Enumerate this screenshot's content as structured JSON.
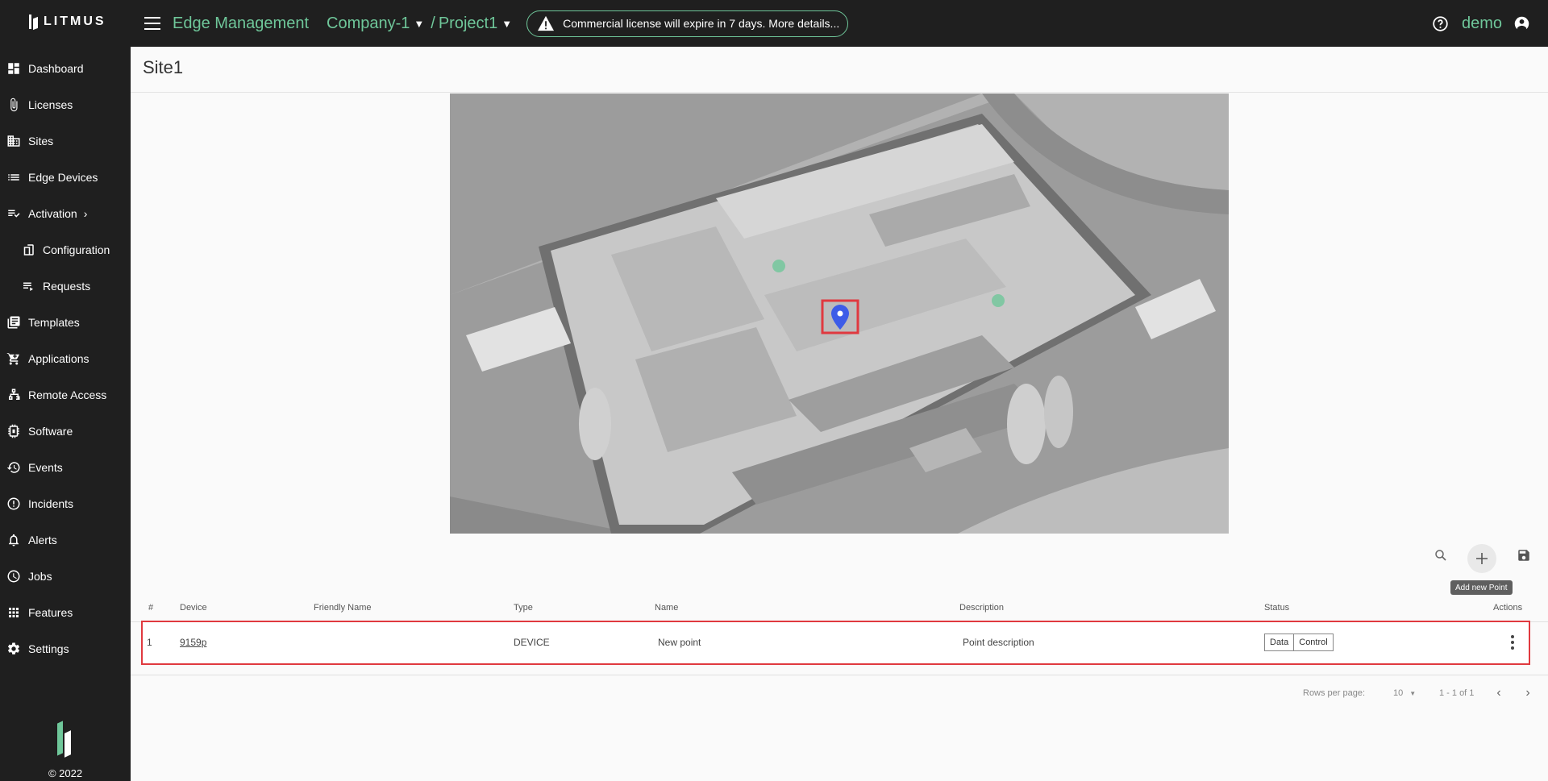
{
  "brand": {
    "logo_text": "LITMUS",
    "copyright": "© 2022"
  },
  "sidebar": {
    "items": [
      {
        "label": "Dashboard",
        "icon": "dashboard-icon"
      },
      {
        "label": "Licenses",
        "icon": "paperclip-icon"
      },
      {
        "label": "Sites",
        "icon": "building-icon"
      },
      {
        "label": "Edge Devices",
        "icon": "list-icon"
      },
      {
        "label": "Activation",
        "icon": "checklist-icon"
      },
      {
        "label": "Configuration",
        "icon": "configuration-icon"
      },
      {
        "label": "Requests",
        "icon": "requests-icon"
      },
      {
        "label": "Templates",
        "icon": "templates-icon"
      },
      {
        "label": "Applications",
        "icon": "cart-icon"
      },
      {
        "label": "Remote Access",
        "icon": "network-icon"
      },
      {
        "label": "Software",
        "icon": "chip-icon"
      },
      {
        "label": "Events",
        "icon": "history-icon"
      },
      {
        "label": "Incidents",
        "icon": "alert-circle-icon"
      },
      {
        "label": "Alerts",
        "icon": "bell-icon"
      },
      {
        "label": "Jobs",
        "icon": "clock-icon"
      },
      {
        "label": "Features",
        "icon": "grid-icon"
      },
      {
        "label": "Settings",
        "icon": "gear-icon"
      }
    ]
  },
  "header": {
    "app_title": "Edge Management",
    "company": "Company-1",
    "separator": "/",
    "project": "Project1",
    "license_notice": "Commercial license will expire in 7 days. More details...",
    "user": "demo"
  },
  "page": {
    "title": "Site1"
  },
  "toolbar": {
    "add_tooltip": "Add new Point"
  },
  "table": {
    "columns": [
      "#",
      "Device",
      "Friendly Name",
      "Type",
      "Name",
      "Description",
      "Status",
      "Actions"
    ],
    "rows": [
      {
        "index": "1",
        "device": "9159p",
        "friendly_name": "",
        "type": "DEVICE",
        "name": "New point",
        "description": "Point description",
        "status": [
          "Data",
          "Control"
        ]
      }
    ]
  },
  "pagination": {
    "rows_per_page_label": "Rows per page:",
    "rows_per_page": "10",
    "range": "1 - 1 of 1"
  },
  "colors": {
    "accent": "#6fc79a",
    "sidebar_bg": "#1f1f1f",
    "highlight": "#e0393f",
    "pin": "#3d5ce8"
  }
}
